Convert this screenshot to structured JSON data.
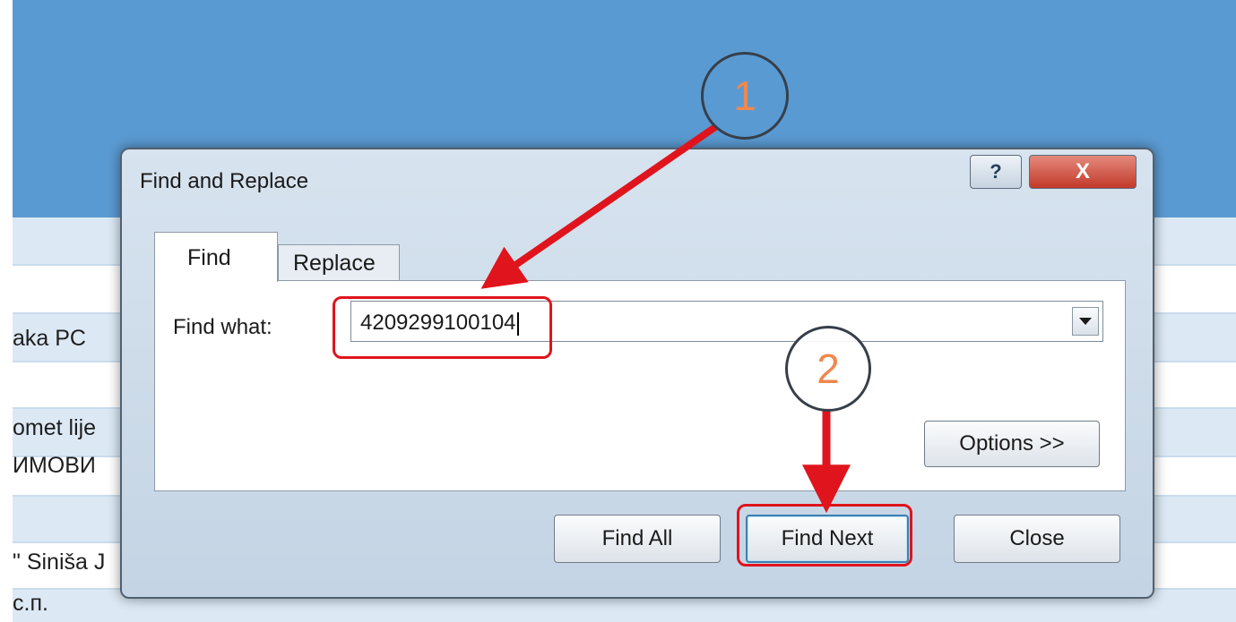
{
  "sheet": {
    "rows": [
      "",
      "aka PC",
      "",
      "omet lije",
      "ИМОВИ",
      "",
      "\" Siniša J",
      "c.п."
    ]
  },
  "dialog": {
    "title": "Find and Replace",
    "help_label": "?",
    "close_x_label": "X",
    "tabs": [
      {
        "label": "Find",
        "active": true
      },
      {
        "label": "Replace",
        "active": false
      }
    ],
    "find_what_label": "Find what:",
    "find_what_value": "4209299100104",
    "options_label": "Options >>",
    "buttons": {
      "find_all": "Find All",
      "find_next": "Find Next",
      "close": "Close"
    }
  },
  "annotations": {
    "step1": "1",
    "step2": "2",
    "colors": {
      "highlight": "#e0141c",
      "number": "#f0884e"
    }
  }
}
